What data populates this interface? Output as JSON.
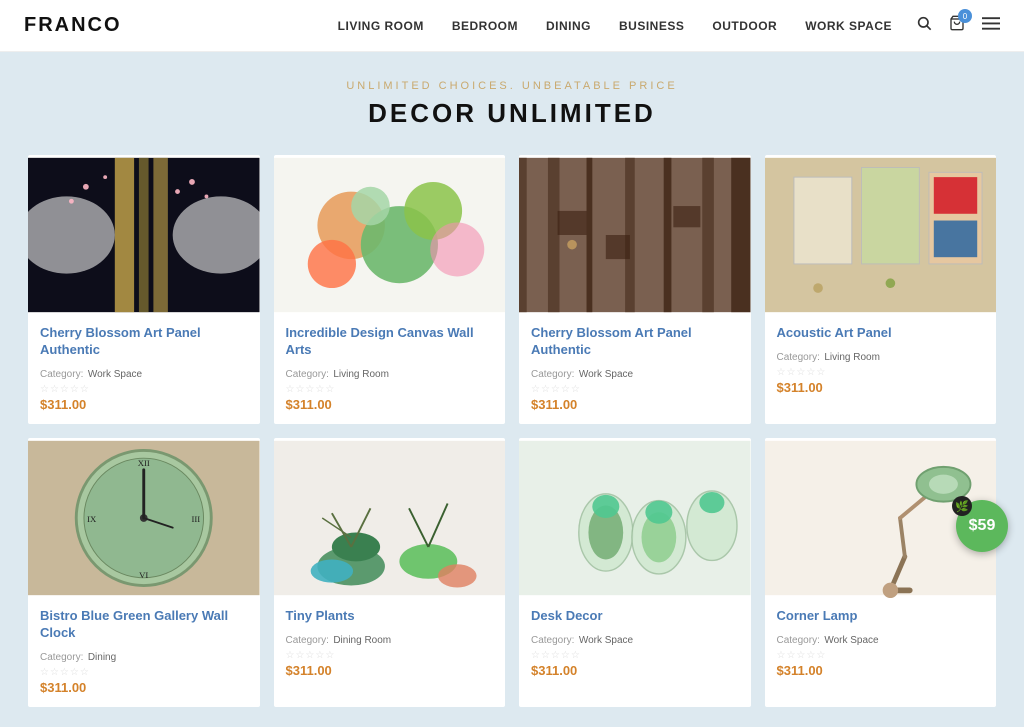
{
  "header": {
    "logo": "FRANCO",
    "nav": [
      {
        "label": "LIVING ROOM",
        "id": "living-room"
      },
      {
        "label": "BEDROOM",
        "id": "bedroom"
      },
      {
        "label": "DINING",
        "id": "dining"
      },
      {
        "label": "BUSINESS",
        "id": "business"
      },
      {
        "label": "OUTDOOR",
        "id": "outdoor"
      },
      {
        "label": "WORK SPACE",
        "id": "workspace"
      }
    ],
    "cart_count": "0"
  },
  "hero": {
    "subtitle": "UNLIMITED CHOICES. UNBEATABLE PRICE",
    "title": "DECOR UNLIMITED"
  },
  "products": [
    {
      "id": "p1",
      "title": "Cherry Blossom Art Panel Authentic",
      "category_label": "Category:",
      "category": "Work Space",
      "price": "$311.00",
      "img_type": "cherry1"
    },
    {
      "id": "p2",
      "title": "Incredible Design Canvas Wall Arts",
      "category_label": "Category:",
      "category": "Living Room",
      "price": "$311.00",
      "img_type": "canvas"
    },
    {
      "id": "p3",
      "title": "Cherry Blossom Art Panel Authentic",
      "category_label": "Category:",
      "category": "Work Space",
      "price": "$311.00",
      "img_type": "cherry2"
    },
    {
      "id": "p4",
      "title": "Acoustic Art Panel",
      "category_label": "Category:",
      "category": "Living Room",
      "price": "$311.00",
      "img_type": "acoustic"
    },
    {
      "id": "p5",
      "title": "Bistro Blue Green Gallery Wall Clock",
      "category_label": "Category:",
      "category": "Dining",
      "price": "$311.00",
      "img_type": "clock"
    },
    {
      "id": "p6",
      "title": "Tiny Plants",
      "category_label": "Category:",
      "category": "Dining Room",
      "price": "$311.00",
      "img_type": "plants"
    },
    {
      "id": "p7",
      "title": "Desk Decor",
      "category_label": "Category:",
      "category": "Work Space",
      "price": "$311.00",
      "img_type": "desk"
    },
    {
      "id": "p8",
      "title": "Corner Lamp",
      "category_label": "Category:",
      "category": "Work Space",
      "price": "$311.00",
      "img_type": "lamp"
    }
  ],
  "floating": {
    "price": "$59",
    "icon": "leaf"
  },
  "stars": "★★★★★"
}
